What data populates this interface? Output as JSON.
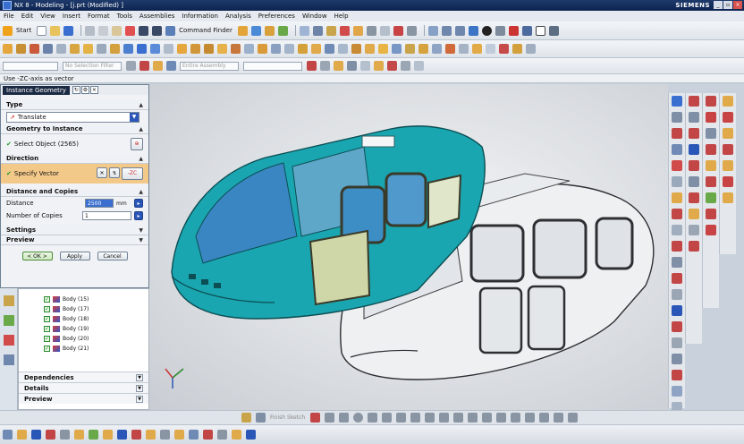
{
  "window": {
    "title": "NX 8 - Modeling - [j.prt (Modified) ]",
    "brand": "SIEMENS",
    "controls": [
      "_",
      "▫",
      "×"
    ]
  },
  "menu": [
    "File",
    "Edit",
    "View",
    "Insert",
    "Format",
    "Tools",
    "Assemblies",
    "Information",
    "Analysis",
    "Preferences",
    "Window",
    "Help"
  ],
  "toolbar": {
    "start_label": "Start",
    "command_finder_label": "Command Finder",
    "snap_filter_placeholder": "No Selection Filter",
    "scope_placeholder": "Entire Assembly"
  },
  "cue_line": "Use -ZC-axis as vector",
  "dialog": {
    "title": "Instance Geometry",
    "type_section": "Type",
    "type_value": "Translate",
    "geometry_section": "Geometry to Instance",
    "select_object": "Select Object (2565)",
    "direction_section": "Direction",
    "specify_vector": "Specify Vector",
    "vector_choice": "-ZC",
    "distance_section": "Distance and Copies",
    "distance_label": "Distance",
    "distance_value": "2500",
    "distance_unit": "mm",
    "copies_label": "Number of Copies",
    "copies_value": "1",
    "settings_section": "Settings",
    "preview_section": "Preview",
    "ok": "< OK >",
    "apply": "Apply",
    "cancel": "Cancel"
  },
  "navigator": {
    "items": [
      "Body (15)",
      "Body (17)",
      "Body (18)",
      "Body (19)",
      "Body (20)",
      "Body (21)"
    ],
    "dependencies": "Dependencies",
    "details": "Details",
    "preview": "Preview"
  },
  "bottom_toolbar": {
    "finish_sketch": "Finish Sketch"
  },
  "colors": {
    "title_bar": "#1b3564",
    "selected_body": "#1aa6b0",
    "preview_body": "#e9ebee",
    "dialog_bg": "#f0f2f5"
  }
}
